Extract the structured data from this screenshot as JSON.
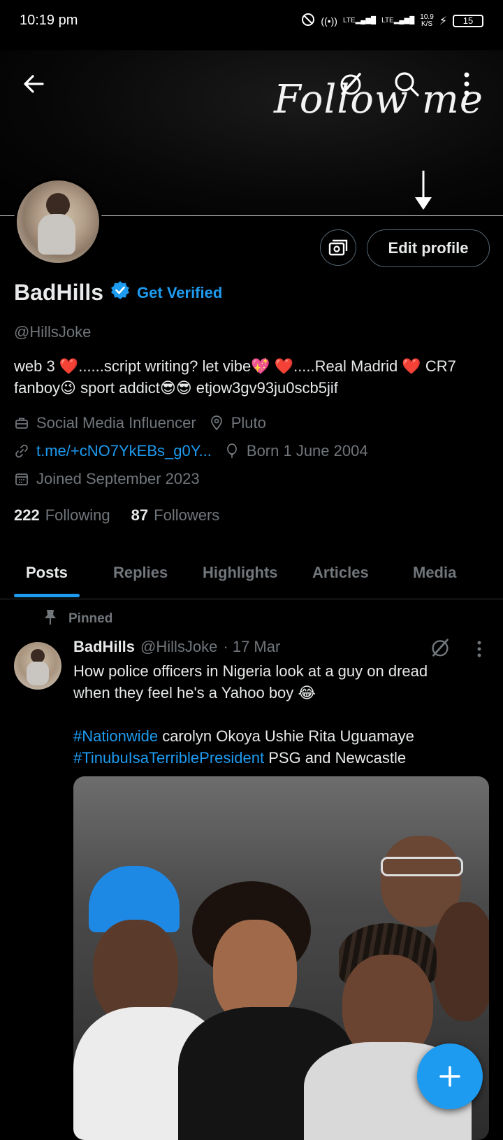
{
  "status_bar": {
    "time": "10:19 pm",
    "net1": "LTE",
    "net2": "LTE",
    "speed_value": "10.9",
    "speed_unit": "K/S",
    "battery": "15"
  },
  "banner": {
    "text": "Follow me"
  },
  "profile": {
    "name": "BadHills",
    "get_verified": "Get Verified",
    "handle": "@HillsJoke",
    "bio_line1": "web 3 ❤️......script writing? let vibe💖 ❤️.....Real Madrid ❤️ CR7",
    "bio_line2": "fanboy😉 sport addict😎😎  etjow3gv93ju0scb5jif",
    "profession": "Social Media Influencer",
    "location": "Pluto",
    "link": "t.me/+cNO7YkEBs_g0Y...",
    "birthday": "Born 1 June 2004",
    "joined": "Joined September 2023",
    "following_count": "222",
    "following_label": "Following",
    "followers_count": "87",
    "followers_label": "Followers",
    "edit_profile": "Edit profile"
  },
  "tabs": [
    {
      "label": "Posts"
    },
    {
      "label": "Replies"
    },
    {
      "label": "Highlights"
    },
    {
      "label": "Articles"
    },
    {
      "label": "Media"
    }
  ],
  "pinned_post": {
    "pinned_label": "Pinned",
    "author": "BadHills",
    "handle": "@HillsJoke",
    "date": "· 17 Mar",
    "text_line1": "How police officers in Nigeria look at a guy on dread",
    "text_line2": "when they feel he's a Yahoo boy 😂",
    "hashtag1": "#Nationwide",
    "text_line3_rest": " carolyn Okoya Ushie Rita Uguamaye",
    "hashtag2": "#TinubuIsaTerriblePresident",
    "text_line4_rest": " PSG and Newcastle"
  },
  "icons": {
    "back": "arrow-left",
    "grok": "grok-slash-circle",
    "search": "magnifier",
    "more": "vertical-dots",
    "fab": "plus"
  },
  "colors": {
    "accent": "#1d9bf0",
    "muted": "#71767b",
    "text": "#e7e9ea",
    "background": "#000000"
  }
}
